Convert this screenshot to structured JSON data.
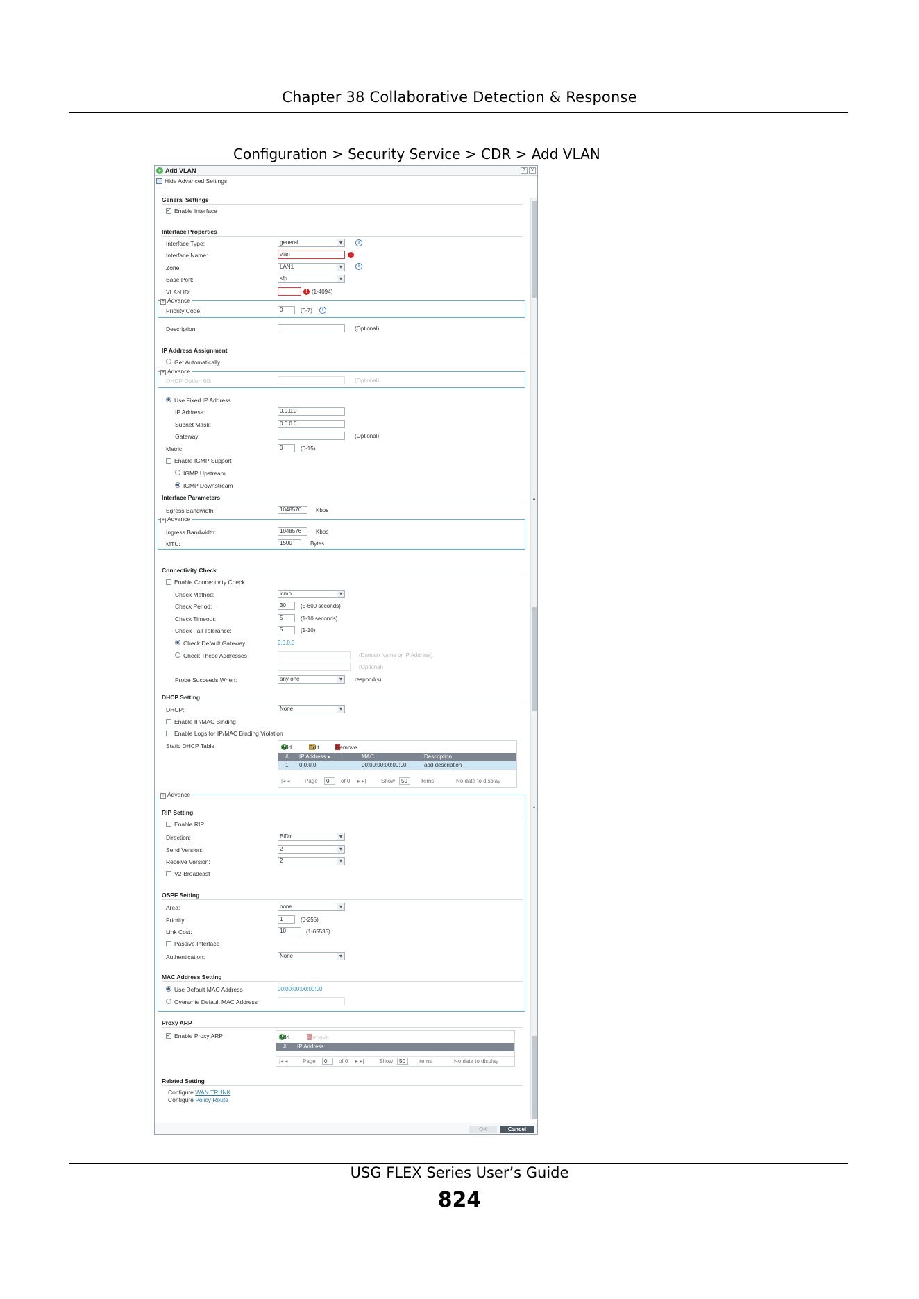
{
  "page": {
    "chapter_title": "Chapter 38 Collaborative Detection & Response",
    "figure_caption": "Configuration > Security Service > CDR > Add VLAN",
    "footer_title": "USG FLEX Series User’s Guide",
    "page_number": "824"
  },
  "dialog": {
    "title": "Add VLAN",
    "help_label": "?",
    "close_label": "X",
    "hide_advanced": "Hide Advanced Settings",
    "advance_label": "Advance",
    "general": {
      "title": "General Settings",
      "enable_interface": "Enable Interface"
    },
    "interface_properties": {
      "title": "Interface Properties",
      "type_label": "Interface Type:",
      "type_value": "general",
      "name_label": "Interface Name:",
      "name_value": "vlan",
      "zone_label": "Zone:",
      "zone_value": "LAN1",
      "base_port_label": "Base Port:",
      "base_port_value": "sfp",
      "vlan_id_label": "VLAN ID:",
      "vlan_id_value": "",
      "vlan_id_hint": "(1-4094)",
      "priority_label": "Priority Code:",
      "priority_value": "0",
      "priority_hint": "(0-7)",
      "description_label": "Description:",
      "description_value": "",
      "description_hint": "(Optional)"
    },
    "ip_assignment": {
      "title": "IP Address Assignment",
      "get_auto": "Get Automatically",
      "dhcp_option_label": "DHCP Option 60:",
      "dhcp_option_hint": "(Optional)",
      "use_fixed": "Use Fixed IP Address",
      "ip_label": "IP Address:",
      "ip_value": "0.0.0.0",
      "mask_label": "Subnet Mask:",
      "mask_value": "0.0.0.0",
      "gateway_label": "Gateway:",
      "gateway_value": "",
      "gateway_hint": "(Optional)",
      "metric_label": "Metric:",
      "metric_value": "0",
      "metric_hint": "(0-15)",
      "igmp_enable": "Enable IGMP Support",
      "igmp_upstream": "IGMP Upstream",
      "igmp_downstream": "IGMP Downstream"
    },
    "interface_params": {
      "title": "Interface Parameters",
      "egress_label": "Egress Bandwidth:",
      "egress_value": "1048576",
      "egress_unit": "Kbps",
      "ingress_label": "Ingress Bandwidth:",
      "ingress_value": "1048576",
      "ingress_unit": "Kbps",
      "mtu_label": "MTU:",
      "mtu_value": "1500",
      "mtu_unit": "Bytes"
    },
    "connectivity": {
      "title": "Connectivity Check",
      "enable": "Enable Connectivity Check",
      "method_label": "Check Method:",
      "method_value": "icmp",
      "period_label": "Check Period:",
      "period_value": "30",
      "period_hint": "(5-600 seconds)",
      "timeout_label": "Check Timeout:",
      "timeout_value": "5",
      "timeout_hint": "(1-10 seconds)",
      "fail_label": "Check Fail Tolerance:",
      "fail_value": "5",
      "fail_hint": "(1-10)",
      "default_gw_label": "Check Default Gateway",
      "default_gw_value": "0.0.0.0",
      "these_addr_label": "Check These Addresses",
      "these_addr_hint": "(Domain Name or IP Address)",
      "these_addr_hint2": "(Optional)",
      "probe_label": "Probe Succeeds When:",
      "probe_value": "any one",
      "probe_hint": "respond(s)"
    },
    "dhcp": {
      "title": "DHCP Setting",
      "dhcp_label": "DHCP:",
      "dhcp_value": "None",
      "ip_mac_binding": "Enable IP/MAC Binding",
      "logs_binding": "Enable Logs for IP/MAC Binding Violation",
      "static_table_label": "Static DHCP Table",
      "toolbar_add": "Add",
      "toolbar_edit": "Edit",
      "toolbar_remove": "Remove",
      "columns": [
        "#",
        "IP Address ▴",
        "MAC",
        "Description"
      ],
      "row": [
        "1",
        "0.0.0.0",
        "00:00:00:00:00:00",
        "add description"
      ],
      "pager_page": "Page",
      "pager_page_value": "0",
      "pager_of": "of 0",
      "pager_show": "Show",
      "pager_show_value": "50",
      "pager_items": "items",
      "pager_empty": "No data to display"
    },
    "rip": {
      "title": "RIP Setting",
      "enable": "Enable RIP",
      "direction_label": "Direction:",
      "direction_value": "BiDir",
      "send_label": "Send Version:",
      "send_value": "2",
      "receive_label": "Receive Version:",
      "receive_value": "2",
      "v2_broadcast": "V2-Broadcast"
    },
    "ospf": {
      "title": "OSPF Setting",
      "area_label": "Area:",
      "area_value": "none",
      "priority_label": "Priority:",
      "priority_value": "1",
      "priority_hint": "(0-255)",
      "cost_label": "Link Cost:",
      "cost_value": "10",
      "cost_hint": "(1-65535)",
      "passive": "Passive Interface",
      "auth_label": "Authentication:",
      "auth_value": "None"
    },
    "mac": {
      "title": "MAC Address Setting",
      "use_default": "Use Default MAC Address",
      "default_value": "00:00:00:00:00:00",
      "overwrite": "Overwrite Default MAC Address"
    },
    "proxy_arp": {
      "title": "Proxy ARP",
      "enable": "Enable Proxy ARP",
      "toolbar_add": "Add",
      "toolbar_remove": "Remove",
      "columns": [
        "#",
        "IP Address"
      ],
      "pager_page": "Page",
      "pager_page_value": "0",
      "pager_of": "of 0",
      "pager_show": "Show",
      "pager_show_value": "50",
      "pager_items": "items",
      "pager_empty": "No data to display"
    },
    "related": {
      "title": "Related Setting",
      "configure_prefix": "Configure",
      "wan_trunk": "WAN TRUNK",
      "policy_route": "Policy Route"
    },
    "ok_label": "OK",
    "cancel_label": "Cancel"
  }
}
